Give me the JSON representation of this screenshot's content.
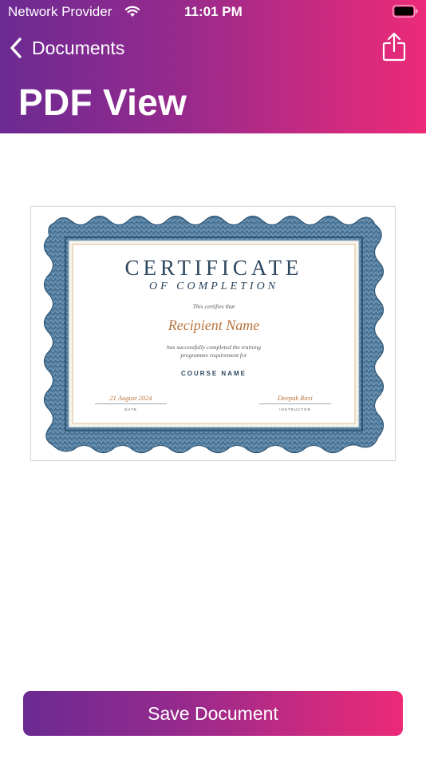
{
  "status_bar": {
    "carrier": "Network Provider",
    "time": "11:01 PM"
  },
  "nav": {
    "back_label": "Documents",
    "title": "PDF View",
    "share_icon": "share-icon"
  },
  "certificate": {
    "title": "CERTIFICATE",
    "subtitle": "OF COMPLETION",
    "certifies_text": "This certifies that",
    "recipient": "Recipient Name",
    "body_line1": "has successfully completed the training",
    "body_line2": "programme requirement for",
    "course": "COURSE NAME",
    "date_value": "21 August 2024",
    "date_label": "DATE",
    "instructor_value": "Deepak Ravi",
    "instructor_label": "INSTRUCTOR"
  },
  "actions": {
    "save_label": "Save Document"
  },
  "colors": {
    "gradient_start": "#6b2a93",
    "gradient_end": "#ec2a78",
    "certificate_border": "#3f6b8f",
    "certificate_ink": "#2c4660",
    "certificate_accent": "#b8733c"
  }
}
